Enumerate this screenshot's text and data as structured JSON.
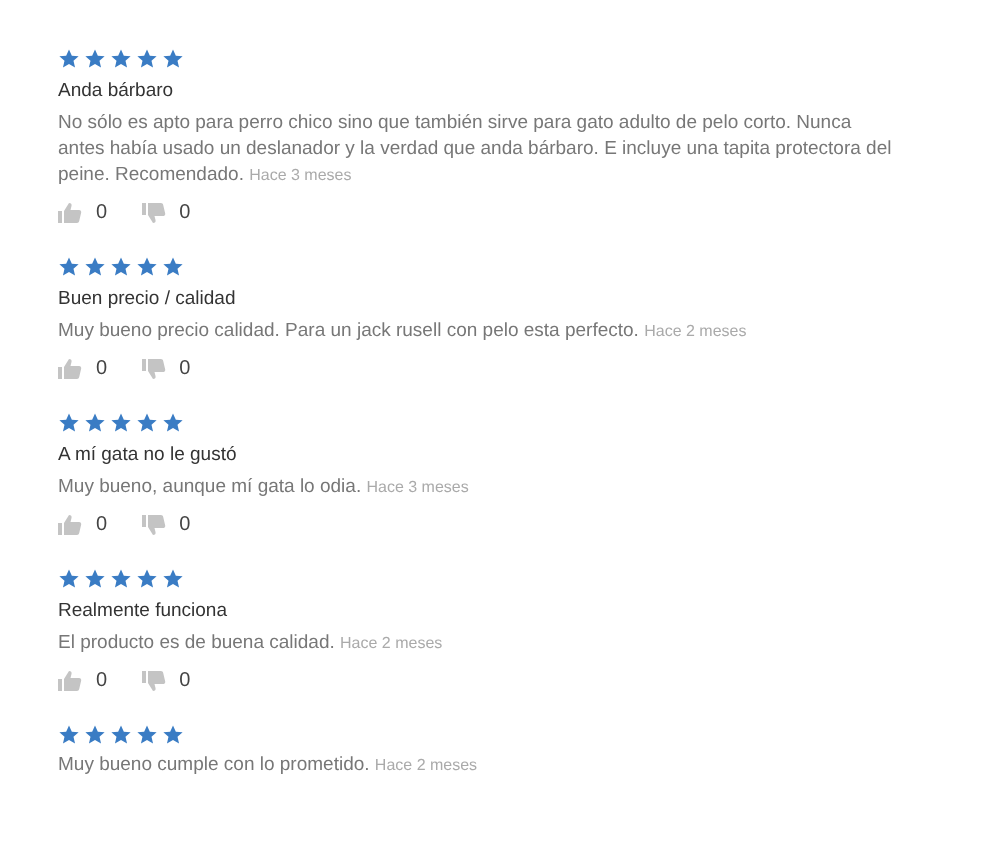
{
  "reviews": [
    {
      "stars": 5,
      "title": "Anda bárbaro",
      "body": "No sólo es apto para perro chico sino que también sirve para gato adulto de pelo corto. Nunca antes había usado un deslanador y la verdad que anda bárbaro. E incluye una tapita protectora del peine. Recomendado.",
      "time": "Hace 3 meses",
      "likes": "0",
      "dislikes": "0"
    },
    {
      "stars": 5,
      "title": "Buen precio / calidad",
      "body": "Muy bueno precio calidad. Para un jack rusell con pelo esta perfecto.",
      "time": "Hace 2 meses",
      "likes": "0",
      "dislikes": "0"
    },
    {
      "stars": 5,
      "title": "A mí gata no le gustó",
      "body": "Muy bueno, aunque mí gata lo odia.",
      "time": "Hace 3 meses",
      "likes": "0",
      "dislikes": "0"
    },
    {
      "stars": 5,
      "title": "Realmente funciona",
      "body": "El producto es de buena calidad.",
      "time": "Hace 2 meses",
      "likes": "0",
      "dislikes": "0"
    },
    {
      "stars": 5,
      "body": "Muy bueno cumple con lo prometido.",
      "time": "Hace 2 meses"
    }
  ]
}
